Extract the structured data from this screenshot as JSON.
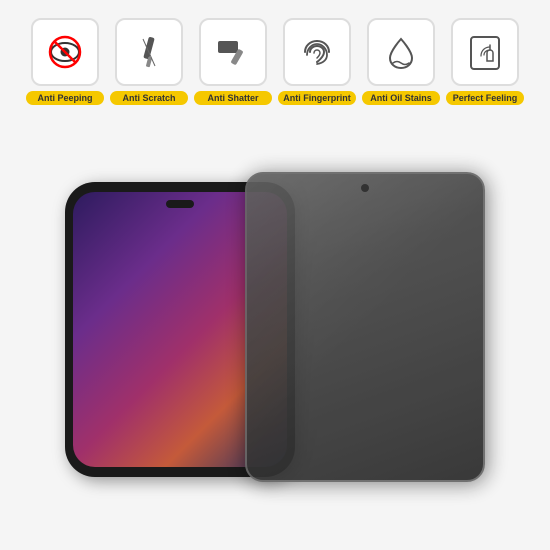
{
  "features": [
    {
      "id": "anti-peeping",
      "label": "Anti Peeping",
      "icon": "eye-slash"
    },
    {
      "id": "anti-scratch",
      "label": "Anti Scratch",
      "icon": "scratch"
    },
    {
      "id": "anti-shatter",
      "label": "Anti Shatter",
      "icon": "hammer"
    },
    {
      "id": "anti-fingerprint",
      "label": "Anti Fingerprint",
      "icon": "fingerprint"
    },
    {
      "id": "anti-oil-stains",
      "label": "Anti Oil Stains",
      "icon": "drop"
    },
    {
      "id": "perfect-feeling",
      "label": "Perfect Feeling",
      "icon": "touch"
    }
  ],
  "colors": {
    "label_bg": "#f5c800",
    "icon_border": "#dddddd",
    "icon_bg": "#ffffff"
  }
}
